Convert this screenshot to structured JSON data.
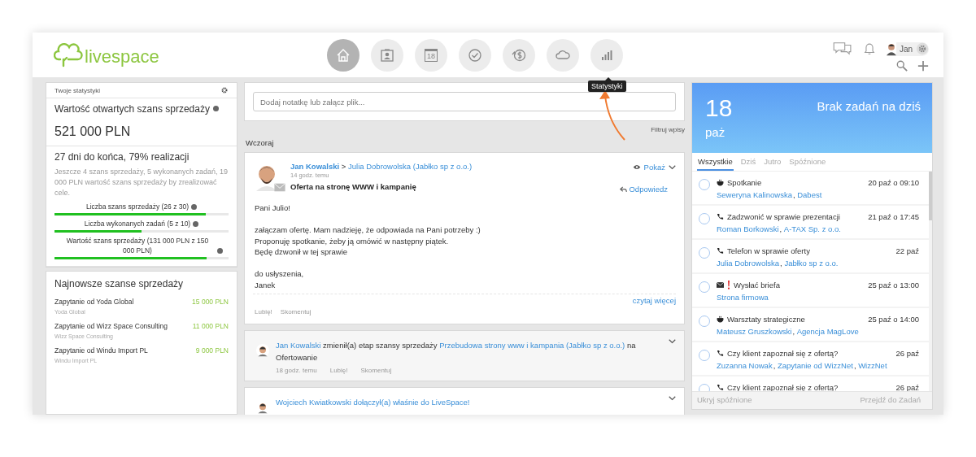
{
  "header": {
    "logo": "livespace",
    "nav": [
      {
        "kind": "home",
        "selected": true
      },
      {
        "kind": "contacts",
        "selected": false
      },
      {
        "kind": "calendar",
        "selected": false,
        "text": "18"
      },
      {
        "kind": "tasks",
        "selected": false
      },
      {
        "kind": "deals",
        "selected": false
      },
      {
        "kind": "cloud",
        "selected": false
      },
      {
        "kind": "stats",
        "selected": false,
        "tooltip": "Statystyki"
      }
    ],
    "user": "Jan"
  },
  "stats": {
    "title": "Twoje statystyki",
    "value_label": "Wartość otwartych szans sprzedaży",
    "value": "521 000 PLN",
    "period": "27 dni do końca, 79% realizacji",
    "remaining": "Jeszcze 4 szans sprzedaży, 5 wykonanych zadań, 19 000 PLN wartość szans sprzedaży by zrealizować cele.",
    "goals": [
      {
        "label": "Liczba szans sprzedaży (26 z 30)",
        "level": 0.87
      },
      {
        "label": "Liczba wykonanych zadań (5 z 10)",
        "level": 0.5
      },
      {
        "label": "Wartość szans sprzedaży (131 000 PLN z 150 000 PLN)",
        "level": 0.873
      }
    ]
  },
  "latest_deals": {
    "title": "Najnowsze szanse sprzedaży",
    "items": [
      {
        "name": "Zapytanie od Yoda Global",
        "company": "Yoda Global",
        "amount": "15 000 PLN"
      },
      {
        "name": "Zapytanie od Wizz Space Consulting",
        "company": "Wizz Space Consulting",
        "amount": "11 000 PLN"
      },
      {
        "name": "Zapytanie od Windu Import PL",
        "company": "Windu Import PL",
        "amount": "9 000 PLN"
      }
    ]
  },
  "feed": {
    "note_placeholder": "Dodaj notatkę lub załącz plik...",
    "filter": "Filtruj wpisy",
    "day": "Wczoraj",
    "posts": [
      {
        "kind": "email",
        "author": "Jan Kowalski",
        "separator": ">",
        "recipient": "Julia Dobrowolska (Jabłko sp z o.o.)",
        "time": "14 godz. temu",
        "subject": "Oferta na stronę WWW i kampanię",
        "show": "Pokaż",
        "reply": "Odpowiedz",
        "body": [
          [
            "Pani Julio!"
          ],
          [
            "załączam ofertę. Mam nadzieję, że odpowiada na Pani potrzeby :)",
            "Proponuję spotkanie, żeby ją omówić w następny piątek.",
            "Będę dzwonił w tej sprawie"
          ],
          [
            "do usłyszenia,",
            "Janek"
          ]
        ],
        "read_more": "czytaj więcej",
        "like": "Lubię!",
        "comment": "Skomentuj"
      },
      {
        "kind": "activity",
        "parts": [
          {
            "text": "Jan Kowalski",
            "link": true
          },
          {
            "text": "zmienił(a) etap szansy sprzedaży",
            "link": false
          },
          {
            "text": "Przebudowa strony www i kampania (Jabłko sp z o.o.)",
            "link": true
          },
          {
            "text": "na",
            "link": false
          },
          {
            "text": "Ofertowanie",
            "link": false
          }
        ],
        "time": "18 godz. temu",
        "like": "Lubię!",
        "comment": "Skomentuj"
      },
      {
        "kind": "activity",
        "parts": [
          {
            "text": "Wojciech Kwiatkowski",
            "link": true
          },
          {
            "text": "dołączył(a) właśnie do LiveSpace!",
            "link": true
          }
        ]
      }
    ]
  },
  "tasks": {
    "day": "18",
    "month": "paż",
    "message": "Brak zadań na dziś",
    "tabs": [
      {
        "label": "Wszystkie",
        "selected": true
      },
      {
        "label": "Dziś",
        "selected": false
      },
      {
        "label": "Jutro",
        "selected": false
      },
      {
        "label": "Spóźnione",
        "selected": false
      }
    ],
    "items": [
      {
        "kind": "meeting",
        "urgent": false,
        "checked": false,
        "title": "Spotkanie",
        "date": "20 paź o 09:10",
        "links": [
          "Seweryna Kalinowska",
          "Dabest"
        ]
      },
      {
        "kind": "call",
        "urgent": false,
        "checked": false,
        "title": "Zadzwonić w sprawie prezentacji",
        "date": "21 paź o 17:45",
        "links": [
          "Roman Borkowski",
          "A-TAX Sp. z o.o."
        ]
      },
      {
        "kind": "call",
        "urgent": false,
        "checked": false,
        "title": "Telefon w sprawie oferty",
        "date": "22 paź",
        "links": [
          "Julia Dobrowolska",
          "Jabłko sp z o.o."
        ]
      },
      {
        "kind": "email",
        "urgent": true,
        "checked": false,
        "title": "Wysłać briefa",
        "date": "25 paź o 13:00",
        "links": [
          "Strona firmowa"
        ]
      },
      {
        "kind": "meeting",
        "urgent": false,
        "checked": false,
        "title": "Warsztaty strategiczne",
        "date": "25 paź o 14:00",
        "links": [
          "Mateusz Gruszkowski",
          "Agencja MagLove"
        ]
      },
      {
        "kind": "call",
        "urgent": false,
        "checked": false,
        "title": "Czy klient zapoznał się z ofertą?",
        "date": "26 paź",
        "links": [
          "Zuzanna Nowak",
          "Zapytanie od WizzNet",
          "WizzNet"
        ]
      },
      {
        "kind": "call",
        "urgent": false,
        "checked": false,
        "title": "Czy klient zapoznał się z ofertą?",
        "date": "26 paź"
      }
    ],
    "link_separator": ",",
    "hide_late": "Ukryj spóźnione",
    "go_tasks": "Przejdź do Zadań"
  }
}
